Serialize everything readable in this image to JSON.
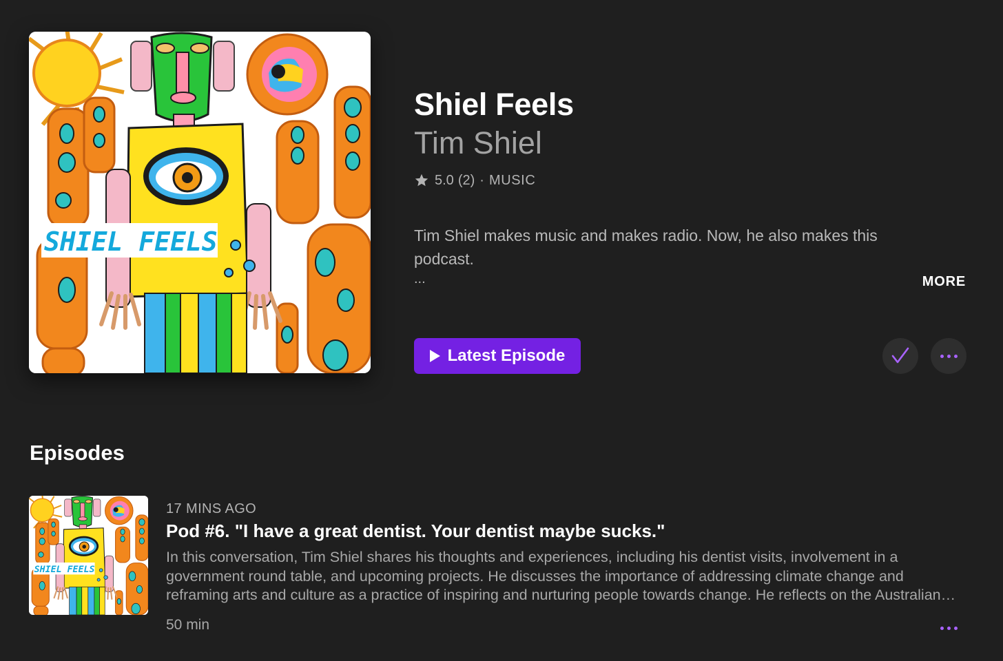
{
  "podcast": {
    "title": "Shiel Feels",
    "author": "Tim Shiel",
    "rating": "5.0",
    "rating_count": "(2)",
    "separator": "·",
    "genre": "MUSIC",
    "description": "Tim Shiel makes music and makes radio. Now, he also makes this podcast.",
    "description_ellipsis": "...",
    "more_label": "MORE",
    "artwork_text": "SHIEL FEELS"
  },
  "actions": {
    "latest_episode_label": "Latest Episode",
    "followed": true
  },
  "episodes_section": {
    "title": "Episodes",
    "items": [
      {
        "date": "17 MINS AGO",
        "title": "Pod #6. \"I have a great dentist. Your dentist maybe sucks.\"",
        "summary": "In this conversation, Tim Shiel shares his thoughts and experiences, including his dentist visits, involvement in a government round table, and upcoming projects. He discusses the importance of addressing climate change and reframing arts and culture as a practice of inspiring and nurturing people towards change. He reflects on the Australian music scene and the future of his creative work.",
        "duration": "50 min"
      }
    ]
  },
  "colors": {
    "background": "#1f1f1f",
    "accent": "#7421e3",
    "accent_light": "#a963ff",
    "primary_text": "#ffffff",
    "secondary_text": "#a3a3a3"
  },
  "icons": {
    "rating": "star-icon",
    "play": "play-icon",
    "follow": "checkmark-icon",
    "options": "ellipsis-icon"
  }
}
